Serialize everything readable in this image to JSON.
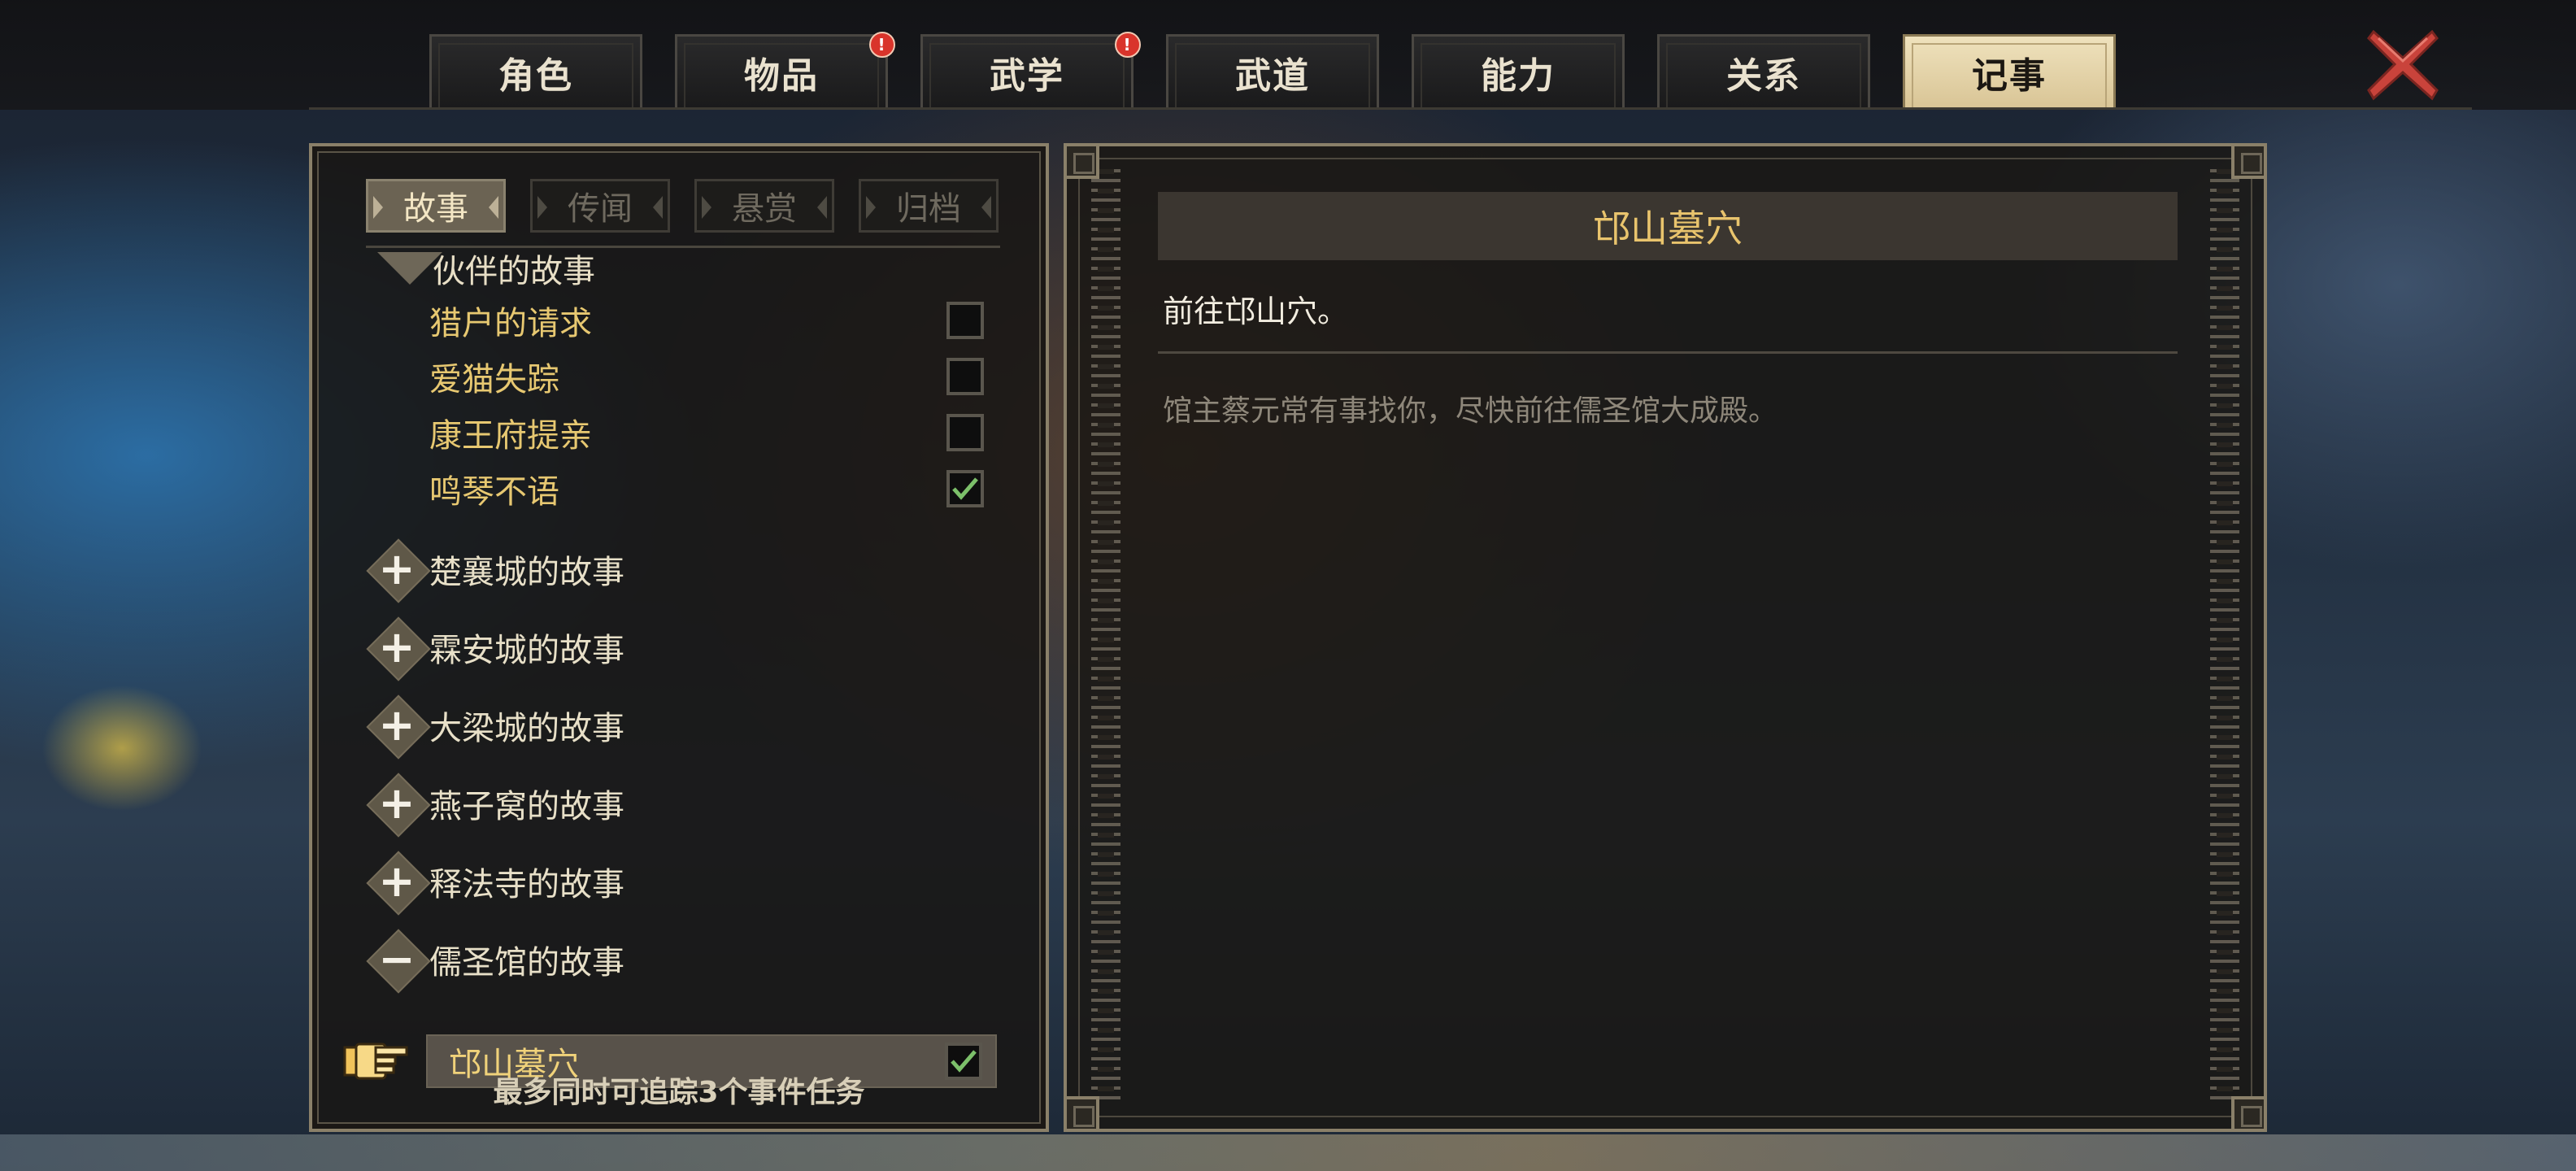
{
  "top_tabs": [
    {
      "label": "角色",
      "active": false,
      "alert": false
    },
    {
      "label": "物品",
      "active": false,
      "alert": true
    },
    {
      "label": "武学",
      "active": false,
      "alert": true
    },
    {
      "label": "武道",
      "active": false,
      "alert": false
    },
    {
      "label": "能力",
      "active": false,
      "alert": false
    },
    {
      "label": "关系",
      "active": false,
      "alert": false
    },
    {
      "label": "记事",
      "active": true,
      "alert": false
    }
  ],
  "alert_mark": "!",
  "close_icon": "close-x-icon",
  "sub_tabs": [
    {
      "label": "故事",
      "active": true
    },
    {
      "label": "传闻",
      "active": false
    },
    {
      "label": "悬赏",
      "active": false
    },
    {
      "label": "归档",
      "active": false
    }
  ],
  "quest_list": {
    "partial_group_label": "伙伴的故事",
    "partner_quests": [
      {
        "label": "猎户的请求",
        "done": false
      },
      {
        "label": "爱猫失踪",
        "done": false
      },
      {
        "label": "康王府提亲",
        "done": false
      },
      {
        "label": "鸣琴不语",
        "done": true
      }
    ],
    "groups": [
      {
        "label": "楚襄城的故事",
        "symbol": "+",
        "expanded": false
      },
      {
        "label": "霖安城的故事",
        "symbol": "+",
        "expanded": false
      },
      {
        "label": "大梁城的故事",
        "symbol": "+",
        "expanded": false
      },
      {
        "label": "燕子窝的故事",
        "symbol": "+",
        "expanded": false
      },
      {
        "label": "释法寺的故事",
        "symbol": "+",
        "expanded": false
      },
      {
        "label": "儒圣馆的故事",
        "symbol": "−",
        "expanded": true
      }
    ],
    "selected_quest": {
      "label": "邙山墓穴",
      "tracked": true
    },
    "footer_note": "最多同时可追踪3个事件任务"
  },
  "detail": {
    "title": "邙山墓穴",
    "goal": "前往邙山穴。",
    "description": "馆主蔡元常有事找你，尽快前往儒圣馆大成殿。"
  },
  "colors": {
    "accent_gold": "#e9c46d",
    "active_tab": "#e5d4a8",
    "check_green": "#7cc06a",
    "alert_red": "#d9342b",
    "close_red": "#c9433b"
  }
}
